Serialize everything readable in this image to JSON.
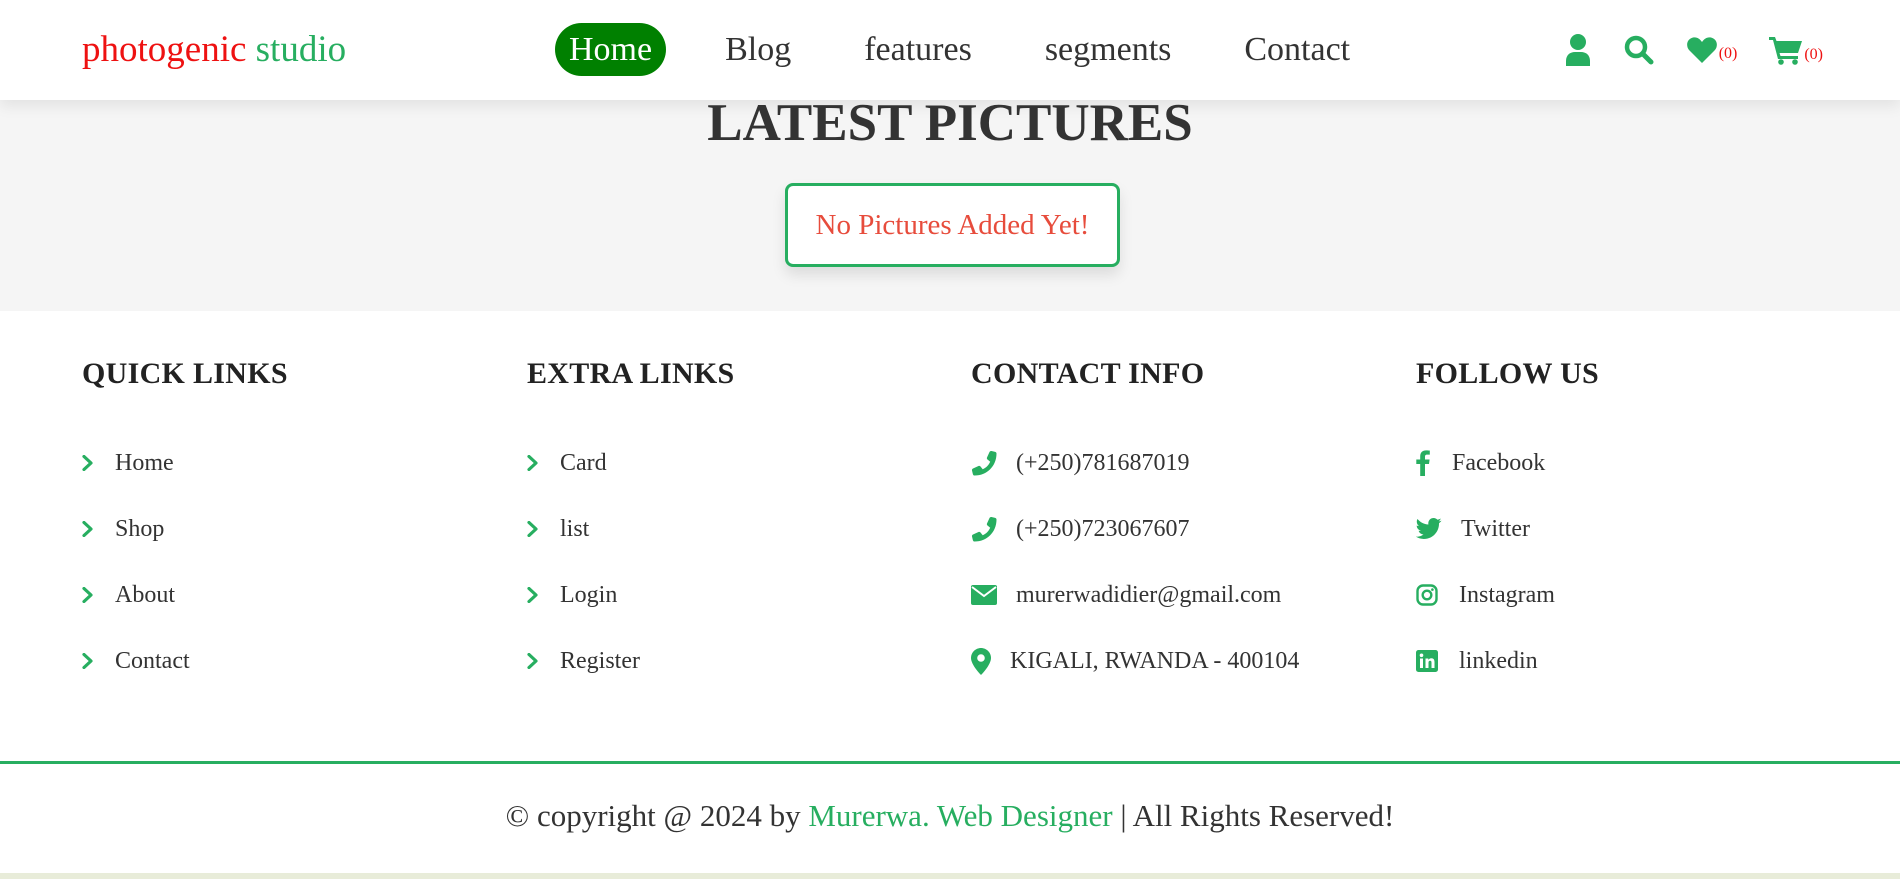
{
  "header": {
    "logo_part1": "photogenic",
    "logo_part2": "studio",
    "nav": [
      {
        "label": "Home",
        "active": true
      },
      {
        "label": "Blog",
        "active": false
      },
      {
        "label": "features",
        "active": false
      },
      {
        "label": "segments",
        "active": false
      },
      {
        "label": "Contact",
        "active": false
      }
    ],
    "icons": {
      "user": "user-icon",
      "search": "search-icon",
      "wishlist": "heart-icon",
      "wishlist_count": "(0)",
      "cart": "cart-icon",
      "cart_count": "(0)"
    }
  },
  "hero": {
    "title": "LATEST PICTURES",
    "empty_message": "No Pictures Added Yet!"
  },
  "footer": {
    "quick_links": {
      "title": "QUICK LINKS",
      "items": [
        "Home",
        "Shop",
        "About",
        "Contact"
      ]
    },
    "extra_links": {
      "title": "EXTRA LINKS",
      "items": [
        "Card",
        "list",
        "Login",
        "Register"
      ]
    },
    "contact_info": {
      "title": "CONTACT INFO",
      "items": [
        {
          "icon": "phone-icon",
          "text": "(+250)781687019"
        },
        {
          "icon": "phone-icon",
          "text": "(+250)723067607"
        },
        {
          "icon": "envelope-icon",
          "text": "murerwadidier@gmail.com"
        },
        {
          "icon": "map-marker-icon",
          "text": "KIGALI, RWANDA - 400104"
        }
      ]
    },
    "follow_us": {
      "title": "FOLLOW US",
      "items": [
        {
          "icon": "facebook-icon",
          "text": "Facebook"
        },
        {
          "icon": "twitter-icon",
          "text": "Twitter"
        },
        {
          "icon": "instagram-icon",
          "text": "Instagram"
        },
        {
          "icon": "linkedin-icon",
          "text": "linkedin"
        }
      ]
    }
  },
  "credit": {
    "prefix": "© copyright @ 2024 by",
    "author": "Murerwa. Web Designer",
    "suffix": "| All Rights Reserved!"
  },
  "colors": {
    "accent": "#27ae60",
    "nav_active": "#008000",
    "logo_red": "#ee1111",
    "error_red": "#e74c3c"
  }
}
